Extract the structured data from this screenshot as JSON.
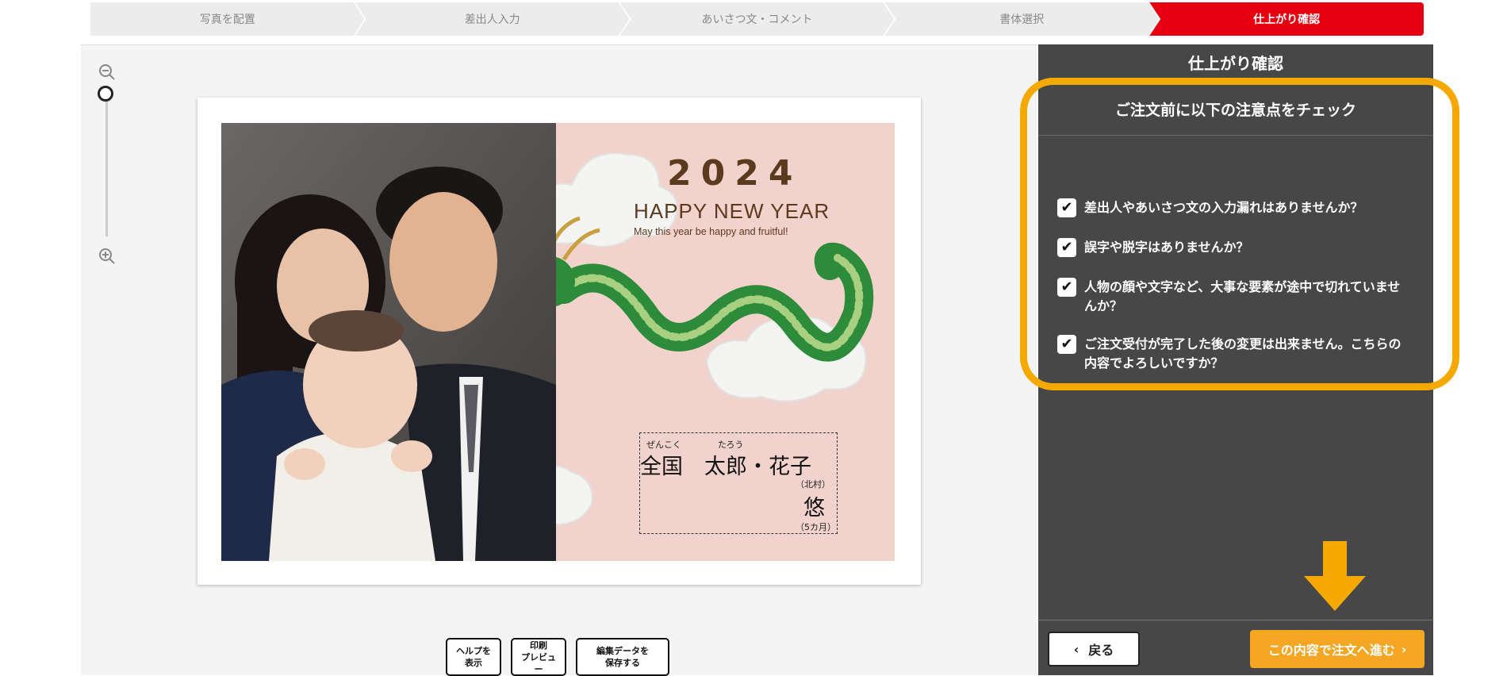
{
  "steps": [
    {
      "label": "写真を配置",
      "active": false
    },
    {
      "label": "差出人入力",
      "active": false
    },
    {
      "label": "あいさつ文・コメント",
      "active": false
    },
    {
      "label": "書体選択",
      "active": false
    },
    {
      "label": "仕上がり確認",
      "active": true
    }
  ],
  "zoom": {
    "out_icon": "zoom-out-icon",
    "in_icon": "zoom-in-icon"
  },
  "card": {
    "year": "2024",
    "greeting": "HAPPY NEW YEAR",
    "tagline": "May this year be happy and fruitful!",
    "sender": {
      "furigana_family": "ぜんこく",
      "furigana_given": "たろう",
      "names": "全国　太郎・花子",
      "note1": "（北村）",
      "child": "悠",
      "note2": "（5カ月）"
    }
  },
  "tools": [
    {
      "line1": "ヘルプを",
      "line2": "表示"
    },
    {
      "line1": "印刷",
      "line2": "プレビュー"
    },
    {
      "line1": "編集データを",
      "line2": "保存する"
    }
  ],
  "panel": {
    "title": "仕上がり確認",
    "check_heading": "ご注文前に以下の注意点をチェック",
    "checks": [
      {
        "text": "差出人やあいさつ文の入力漏れはありませんか？",
        "checked": true
      },
      {
        "text": "誤字や脱字はありませんか？",
        "checked": true
      },
      {
        "text": "人物の顔や文字など、大事な要素が途中で切れていませんか？",
        "checked": true
      },
      {
        "text": "ご注文受付が完了した後の変更は出来ません。こちらの内容でよろしいですか？",
        "checked": true
      }
    ],
    "back_label": "戻る",
    "proceed_label": "この内容で注文へ進む"
  },
  "colors": {
    "accent": "#e60012",
    "highlight": "#f5a800",
    "proceed": "#f5a623",
    "panel": "#474747"
  }
}
